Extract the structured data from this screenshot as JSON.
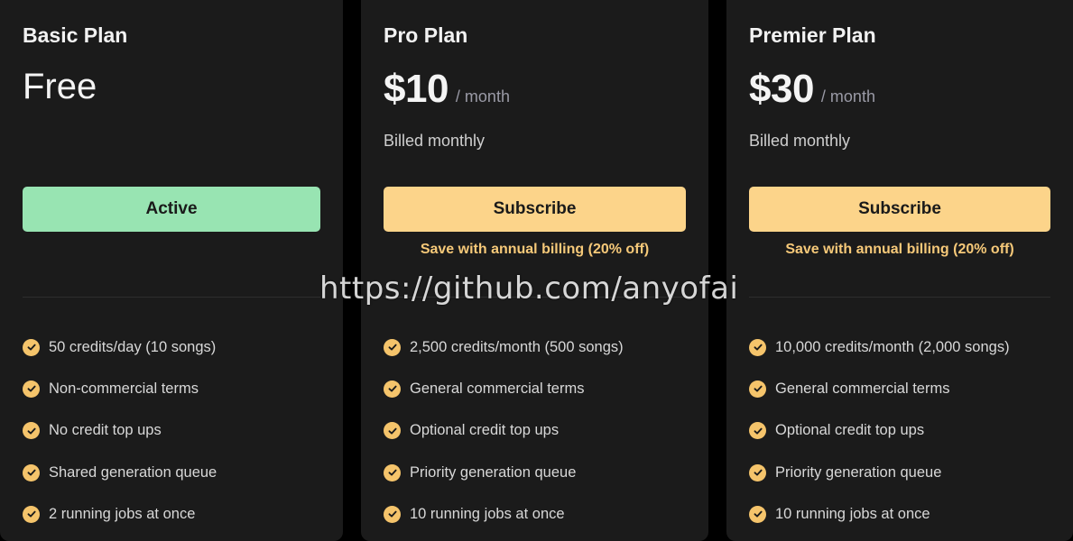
{
  "plans": [
    {
      "name": "Basic Plan",
      "price": "Free",
      "button_label": "Active",
      "features": [
        "50 credits/day (10 songs)",
        "Non-commercial terms",
        "No credit top ups",
        "Shared generation queue",
        "2 running jobs at once"
      ]
    },
    {
      "name": "Pro Plan",
      "price": "$10",
      "per": "/ month",
      "billed": "Billed monthly",
      "button_label": "Subscribe",
      "save_note": "Save with annual billing (20% off)",
      "features": [
        "2,500 credits/month (500 songs)",
        "General commercial terms",
        "Optional credit top ups",
        "Priority generation queue",
        "10 running jobs at once"
      ]
    },
    {
      "name": "Premier Plan",
      "price": "$30",
      "per": "/ month",
      "billed": "Billed monthly",
      "button_label": "Subscribe",
      "save_note": "Save with annual billing (20% off)",
      "features": [
        "10,000 credits/month (2,000 songs)",
        "General commercial terms",
        "Optional credit top ups",
        "Priority generation queue",
        "10 running jobs at once"
      ]
    }
  ],
  "watermark": "https://github.com/anyofai",
  "colors": {
    "card_bg": "#1b1b1b",
    "active_button": "#98e4b2",
    "subscribe_button": "#fcd48a",
    "save_note": "#f6c979",
    "check_icon": "#f5c46b"
  },
  "icons": {
    "feature_check": "check-circle-icon"
  }
}
